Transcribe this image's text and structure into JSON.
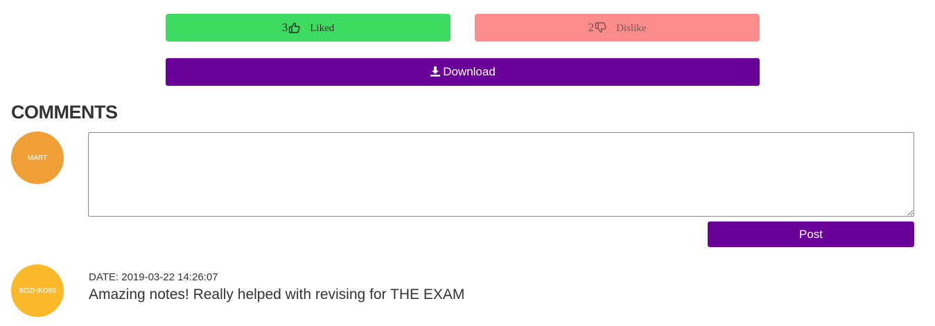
{
  "votes": {
    "like": {
      "count": "3",
      "label": "Liked",
      "icon": "thumbs-up-icon",
      "color": "#3ddc60"
    },
    "dislike": {
      "count": "2",
      "label": "Dislike",
      "icon": "thumbs-down-icon",
      "color": "#ff8c8c"
    }
  },
  "download": {
    "label": "Download",
    "icon": "download-icon",
    "color": "#6a0099"
  },
  "comments": {
    "title": "COMMENTS",
    "current_user": {
      "avatar_text": "MART",
      "avatar_color": "#ef9f36"
    },
    "input": {
      "value": "",
      "placeholder": ""
    },
    "post_label": "Post",
    "items": [
      {
        "user": "BOZHKO99",
        "avatar_color": "#fbb92a",
        "date": "DATE: 2019-03-22 14:26:07",
        "text": "Amazing notes! Really helped with revising for THE EXAM"
      }
    ]
  }
}
